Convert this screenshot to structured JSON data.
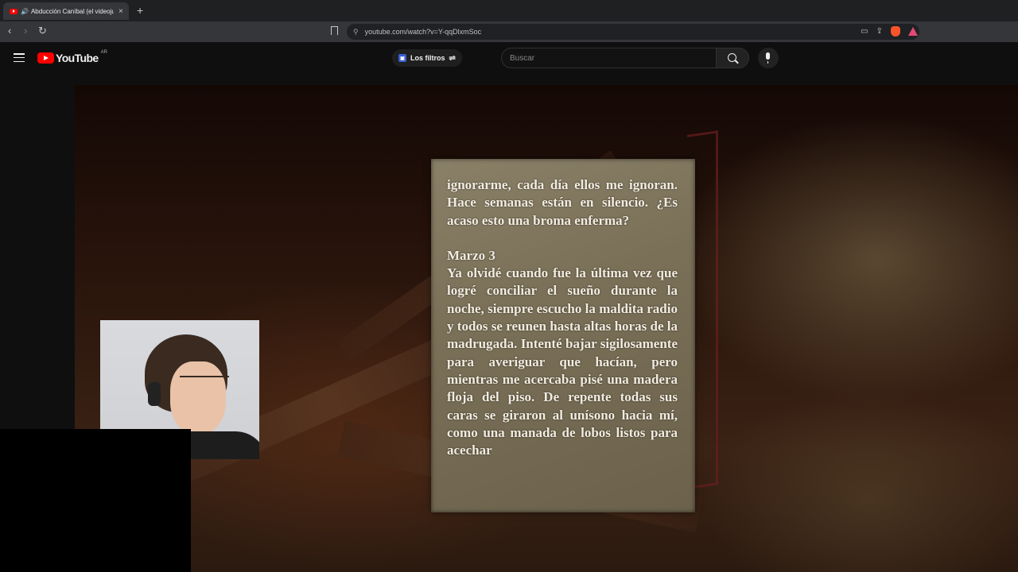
{
  "browser": {
    "tab_title": "Abducción Caníbal (el videojuego",
    "tab_close": "×",
    "new_tab": "+",
    "url": "youtube.com/watch?v=Y-qqDlxmSoc"
  },
  "youtube": {
    "logo_text": "YouTube",
    "country_code": "AR",
    "filters_label": "Los filtros",
    "search_placeholder": "Buscar"
  },
  "video": {
    "note_paragraph_1": "ignorarme, cada día ellos me ignoran. Hace semanas están en silencio. ¿Es acaso esto una broma enferma?",
    "note_date": "Marzo 3",
    "note_paragraph_2": "Ya olvidé cuando fue la última vez que logré conciliar el sueño durante la noche, siempre escucho la maldita radio y todos se reunen hasta altas horas de la madrugada. Intenté bajar sigilosamente para averiguar que hacían, pero mientras me acercaba pisé una madera floja del piso. De repente todas sus caras se giraron al unísono hacia mí, como una manada de lobos listos para acechar"
  },
  "colors": {
    "youtube_red": "#ff0000",
    "page_background": "#0f0f0f",
    "note_paper": "#7a7058"
  }
}
